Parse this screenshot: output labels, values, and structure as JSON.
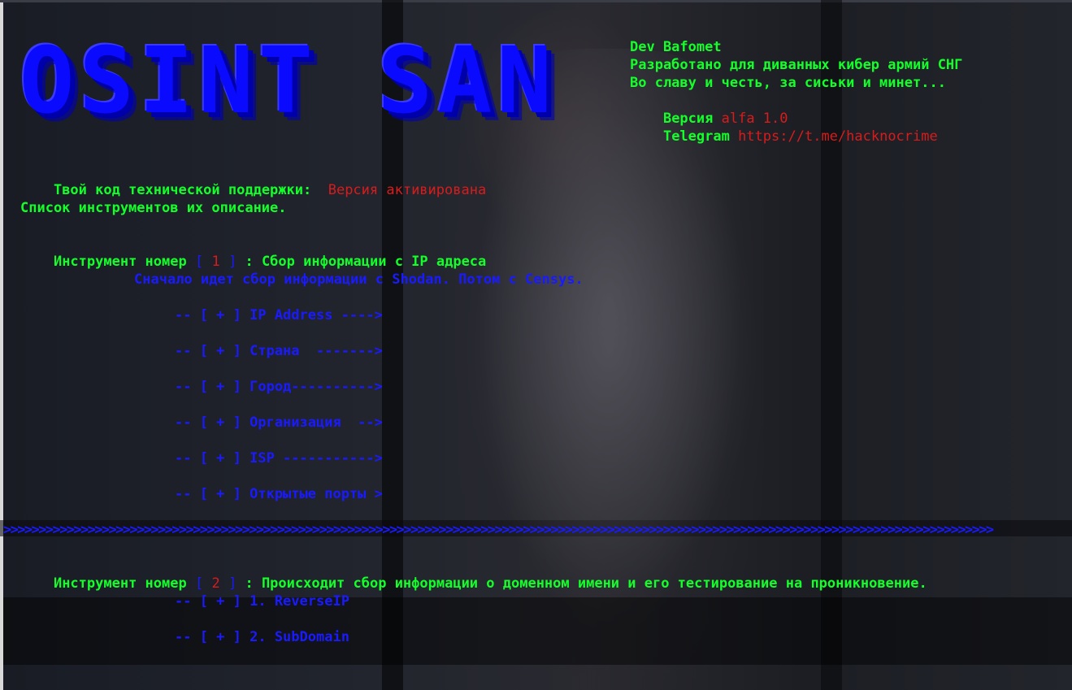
{
  "logo": {
    "text": "OSINT SAN"
  },
  "header_info": {
    "dev": "Dev Bafomet",
    "developed_for": "Разработано для диванных кибер армий СНГ",
    "glory": "Во славу и честь, за сиськи и минет...",
    "version_label": "Версия",
    "version_value": "alfa 1.0",
    "telegram_label": "Telegram",
    "telegram_value": "https://t.me/hacknocrime"
  },
  "support": {
    "label": "Твой код технической поддержки:",
    "value": "Версия активирована"
  },
  "tools_list_heading": "Список инструментов их описание.",
  "tool1": {
    "prefix": "Инструмент номер",
    "bracket_open": "[",
    "number": "1",
    "bracket_close": "]",
    "description": ": Сбор информации с IP адреса",
    "note": "Сначало идет сбор информации с Shodan. Потом с Censys.",
    "items": [
      "-- [ + ] IP Address ---->",
      "-- [ + ] Страна  ------->",
      "-- [ + ] Город---------->",
      "-- [ + ] Организация  -->",
      "-- [ + ] ISP ----------->",
      "-- [ + ] Открытые порты >"
    ]
  },
  "separator": ">>>>>>>>>>>>>>>>>>>>>>>>>>>>>>>>>>>>>>>>>>>>>>>>>>>>>>>>>>>>>>>>>>>>>>>>>>>>>>>>>>>>>>>>>>>>>>>>>>>>>>>>>>>>>>>>>>>>>>>>>>>>>>>>>>>>>>>>>>>>>",
  "tool2": {
    "prefix": "Инструмент номер",
    "bracket_open": "[",
    "number": "2",
    "bracket_close": "]",
    "description": ": Происходит сбор информации о доменном имени и его тестирование на проникновение.",
    "items": [
      "-- [ + ] 1. ReverseIP",
      "-- [ + ] 2. SubDomain"
    ]
  },
  "colors": {
    "green": "#14ff2a",
    "red": "#d81c1c",
    "blue": "#1a1aff"
  }
}
